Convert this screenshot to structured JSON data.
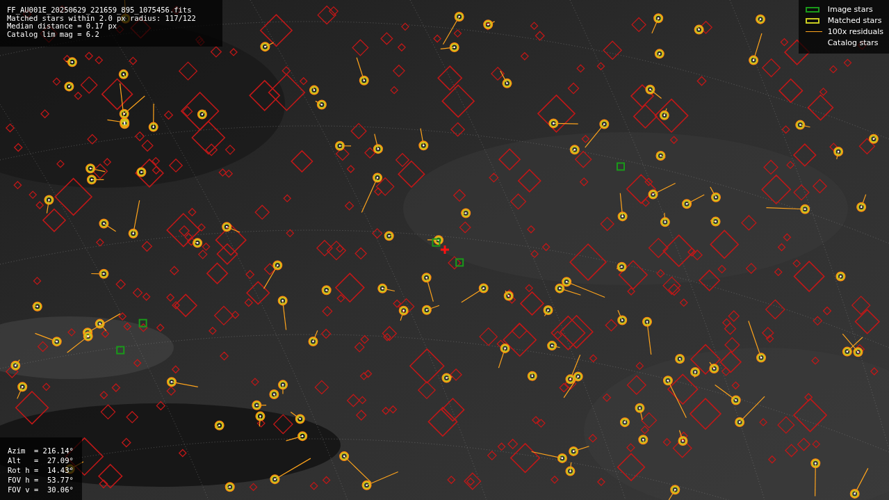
{
  "info": {
    "lines": [
      "FF_AU001E_20250629_221659_895_1075456.fits",
      "Matched stars within 2.0 px radius: 117/122",
      "Median distance = 0.17 px",
      "Catalog lim mag = 6.2"
    ]
  },
  "legend": [
    {
      "label": "Image stars"
    },
    {
      "kind": "matched",
      "label": "Matched stars"
    },
    {
      "kind": "residual",
      "label": "100x residuals"
    },
    {
      "kind": "catalog",
      "label": "Catalog stars"
    }
  ],
  "pointing": {
    "lines": [
      "Azim  = 216.14°",
      "Alt   =  27.09°",
      "Rot h =  14.43°",
      "FOV h =  53.77°",
      "FOV v =  30.06°"
    ]
  }
}
